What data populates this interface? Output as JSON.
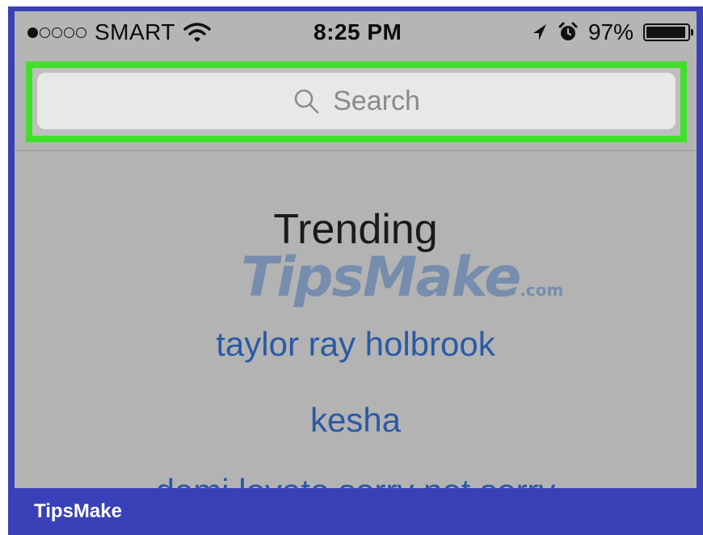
{
  "status_bar": {
    "signal_dots_filled": 1,
    "signal_dots_total": 5,
    "carrier": "SMART",
    "time": "8:25 PM",
    "battery": "97%"
  },
  "search": {
    "placeholder": "Search"
  },
  "trending": {
    "heading": "Trending",
    "items": [
      "taylor ray holbrook",
      "kesha",
      "demi lovato sorry not sorry"
    ]
  },
  "watermark": {
    "text": "TipsMake",
    "suffix": ".com"
  },
  "footer": {
    "brand": "TipsMake"
  },
  "colors": {
    "frame": "#3a40b8",
    "highlight": "#3fe02a",
    "link": "#2a59a6",
    "screen_bg": "#b3b3b3"
  }
}
